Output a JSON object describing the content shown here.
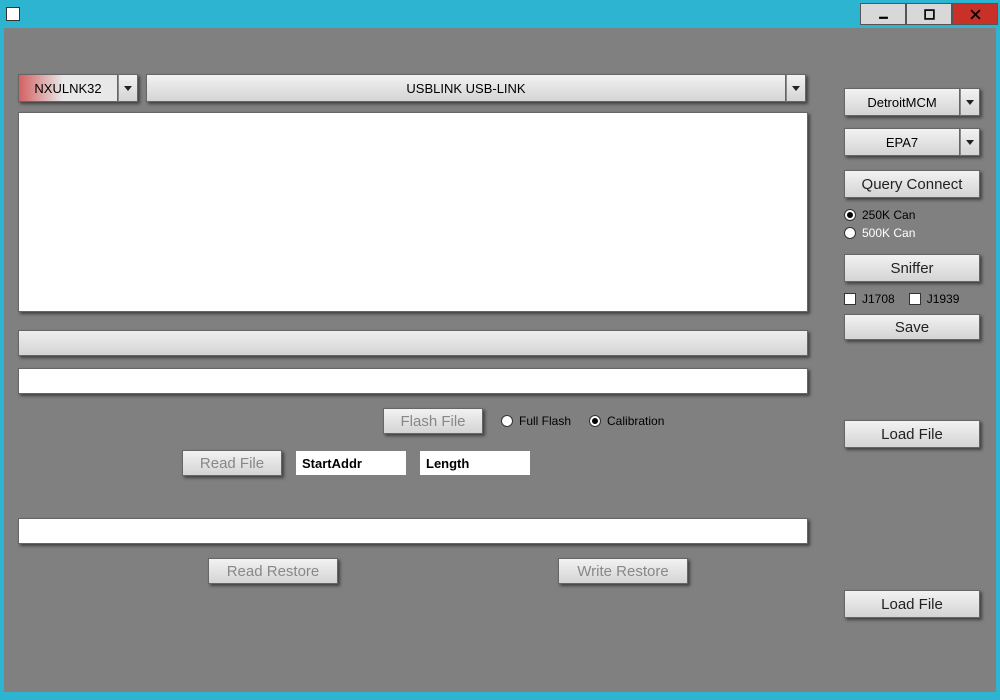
{
  "titlebar": {
    "title": ""
  },
  "top": {
    "adapter": "NXULNK32",
    "device": "USBLINK USB-LINK"
  },
  "right": {
    "model": "DetroitMCM",
    "epa": "EPA7",
    "query_connect": "Query Connect",
    "can250": "250K Can",
    "can500": "500K Can",
    "sniffer": "Sniffer",
    "j1708": "J1708",
    "j1939": "J1939",
    "save": "Save",
    "load_file1": "Load File",
    "load_file2": "Load File"
  },
  "main": {
    "flash_file": "Flash File",
    "full_flash": "Full Flash",
    "calibration": "Calibration",
    "read_file": "Read File",
    "start_addr_label": "StartAddr",
    "length_label": "Length",
    "read_restore": "Read Restore",
    "write_restore": "Write Restore"
  }
}
